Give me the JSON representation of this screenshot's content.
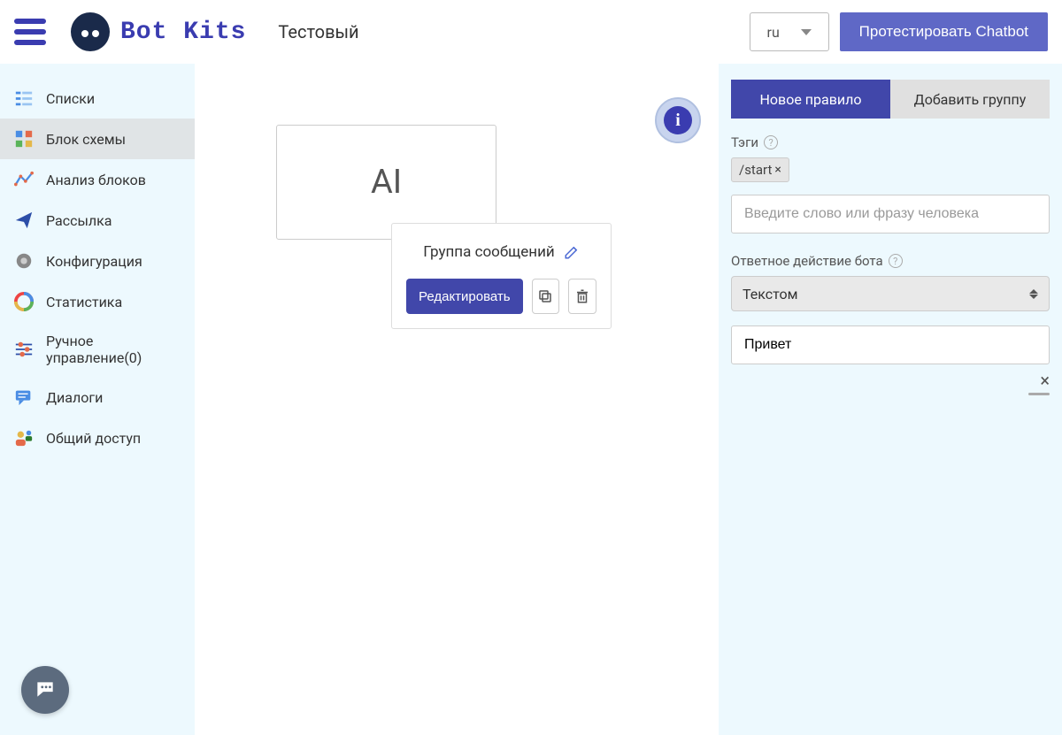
{
  "header": {
    "brand": "Bot Kits",
    "title": "Тестовый",
    "lang": "ru",
    "test_btn": "Протестировать Chatbot"
  },
  "sidebar": {
    "items": [
      {
        "label": "Списки",
        "icon": "list-icon"
      },
      {
        "label": "Блок схемы",
        "icon": "blocks-icon",
        "active": true
      },
      {
        "label": "Анализ блоков",
        "icon": "analysis-icon"
      },
      {
        "label": "Рассылка",
        "icon": "send-icon"
      },
      {
        "label": "Конфигурация",
        "icon": "gear-icon"
      },
      {
        "label": "Статистика",
        "icon": "chart-icon"
      },
      {
        "label": "Ручное управление(0)",
        "icon": "sliders-icon"
      },
      {
        "label": "Диалоги",
        "icon": "dialog-icon"
      },
      {
        "label": "Общий доступ",
        "icon": "share-icon"
      }
    ]
  },
  "canvas": {
    "ai_block_label": "AI",
    "group_title": "Группа сообщений",
    "edit_btn": "Редактировать"
  },
  "right": {
    "tabs": {
      "new_rule": "Новое правило",
      "add_group": "Добавить группу"
    },
    "tags_label": "Тэги",
    "tag_value": "/start",
    "phrase_placeholder": "Введите слово или фразу человека",
    "action_label": "Ответное действие бота",
    "action_value": "Текстом",
    "reply_value": "Привет"
  }
}
